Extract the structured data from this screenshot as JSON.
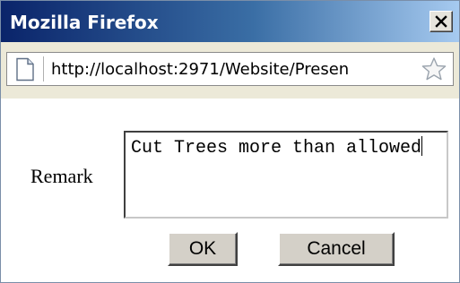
{
  "window": {
    "title": "Mozilla Firefox"
  },
  "urlbar": {
    "url": "http://localhost:2971/Website/Presen"
  },
  "form": {
    "remark_label": "Remark",
    "remark_value": "Cut Trees more than allowed"
  },
  "buttons": {
    "ok_label": "OK",
    "cancel_label": "Cancel"
  },
  "colors": {
    "titlebar_start": "#0a246a",
    "titlebar_end": "#a6caf0",
    "button_face": "#d4d0c8"
  },
  "icons": {
    "close": "close-icon",
    "page": "page-icon",
    "bookmark": "star-icon"
  }
}
